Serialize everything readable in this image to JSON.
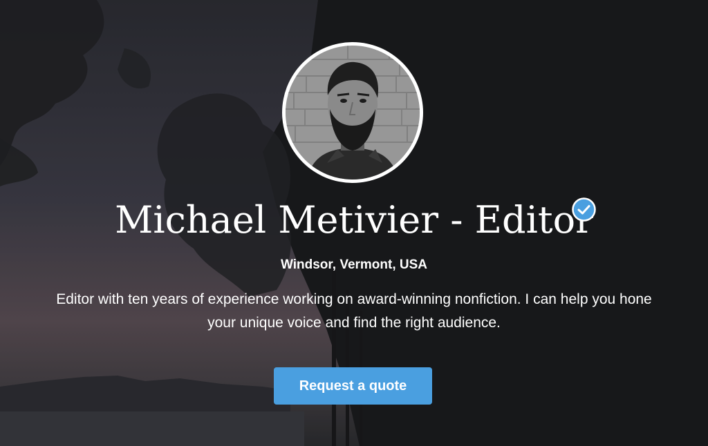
{
  "profile": {
    "name": "Michael Metivier - Editor",
    "location": "Windsor, Vermont, USA",
    "bio": "Editor with ten years of experience working on award-winning nonfiction. I can help you hone your unique voice and find the right audience.",
    "verified_icon": "verified-check-icon",
    "verified_color": "#4a9fe0",
    "avatar_icon": "profile-photo"
  },
  "cta": {
    "label": "Request a quote",
    "color": "#4a9fe0"
  },
  "background": {
    "description_icon": "dusk-lake-trees-photo"
  }
}
